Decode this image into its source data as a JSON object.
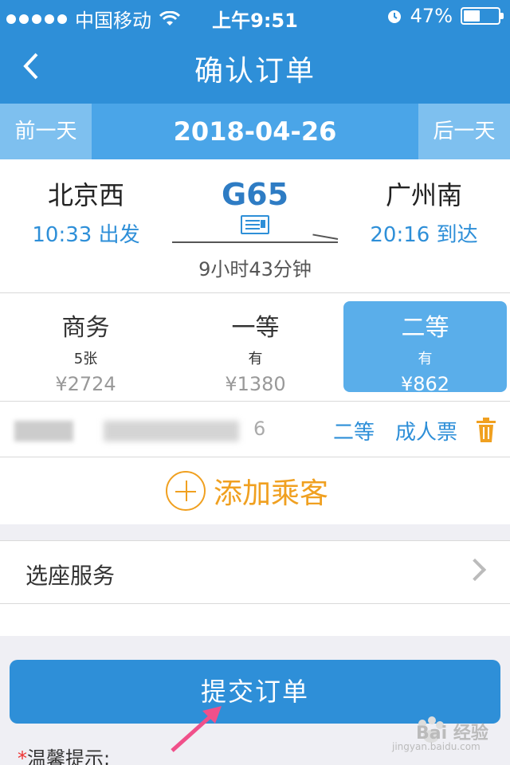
{
  "status_bar": {
    "carrier": "中国移动",
    "time": "上午9:51",
    "battery": "47%",
    "battery_level": 0.47
  },
  "nav": {
    "title": "确认订单",
    "back_icon": "chevron-left-icon"
  },
  "date_bar": {
    "prev_label": "前一天",
    "date": "2018-04-26",
    "next_label": "后一天"
  },
  "train": {
    "from_station": "北京西",
    "depart": "10:33 出发",
    "number": "G65",
    "to_station": "广州南",
    "arrive": "20:16 到达",
    "duration": "9小时43分钟"
  },
  "seats": [
    {
      "class": "商务",
      "availability": "5张",
      "price": "¥2724",
      "selected": false
    },
    {
      "class": "一等",
      "availability": "有",
      "price": "¥1380",
      "selected": false
    },
    {
      "class": "二等",
      "availability": "有",
      "price": "¥862",
      "selected": true
    }
  ],
  "passenger": {
    "id_tail": "6",
    "seat_class": "二等",
    "ticket_type": "成人票"
  },
  "add_passenger": {
    "label": "添加乘客"
  },
  "seat_service": {
    "label": "选座服务"
  },
  "submit": {
    "label": "提交订单"
  },
  "tip": {
    "star": "*",
    "label": "温馨提示:"
  },
  "watermark": {
    "text": "Bai 经验",
    "sub": "jingyan.baidu.com"
  },
  "colors": {
    "primary": "#2e8fd8",
    "selected_seat": "#5aaeea",
    "accent": "#f0a020"
  }
}
